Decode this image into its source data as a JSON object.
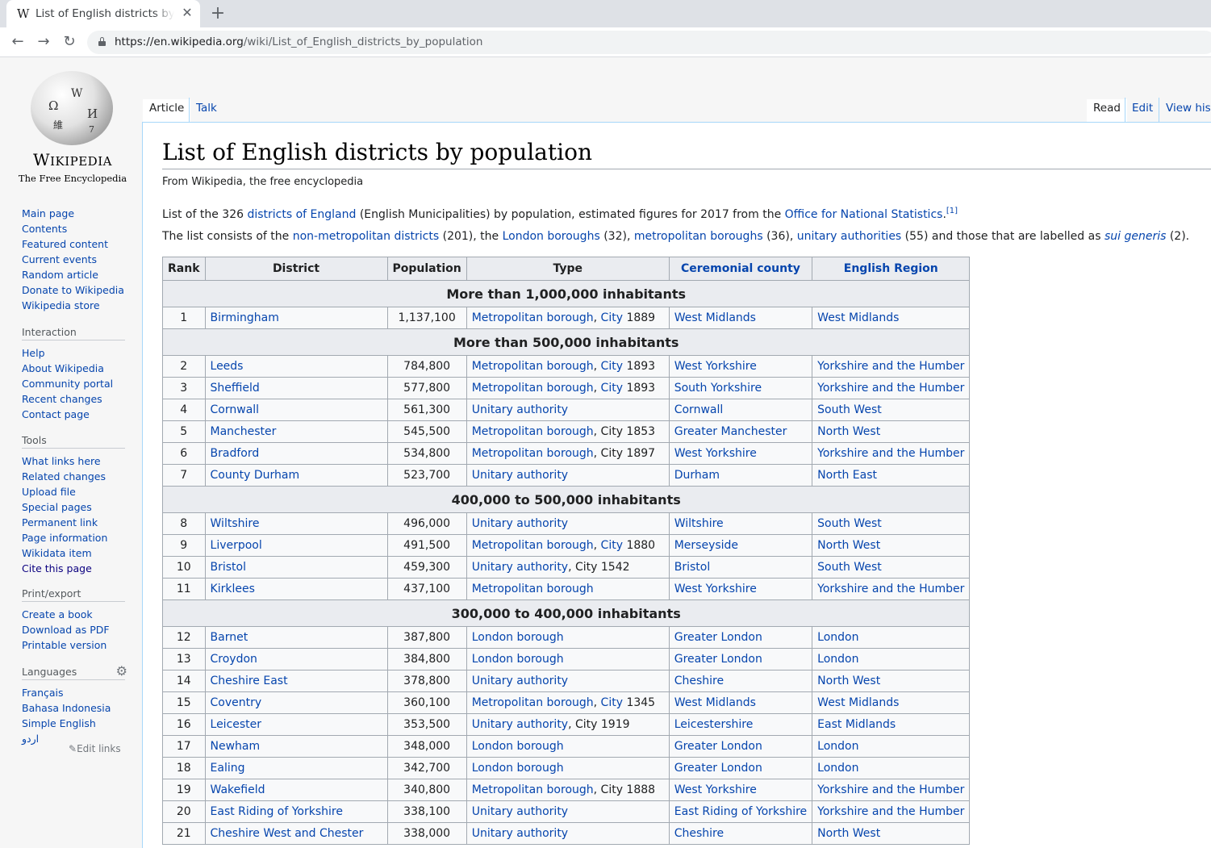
{
  "browser": {
    "tab_title": "List of English districts by population",
    "favicon": "W",
    "url_host": "https://en.wikipedia.org",
    "url_path": "/wiki/List_of_English_districts_by_population"
  },
  "logo": {
    "wordmark": "Wikipedia",
    "tagline": "The Free Encyclopedia"
  },
  "sidebar": {
    "navigation": [
      "Main page",
      "Contents",
      "Featured content",
      "Current events",
      "Random article",
      "Donate to Wikipedia",
      "Wikipedia store"
    ],
    "interaction_title": "Interaction",
    "interaction": [
      "Help",
      "About Wikipedia",
      "Community portal",
      "Recent changes",
      "Contact page"
    ],
    "tools_title": "Tools",
    "tools": [
      "What links here",
      "Related changes",
      "Upload file",
      "Special pages",
      "Permanent link",
      "Page information",
      "Wikidata item",
      "Cite this page"
    ],
    "print_title": "Print/export",
    "print": [
      "Create a book",
      "Download as PDF",
      "Printable version"
    ],
    "languages_title": "Languages",
    "languages": [
      "Français",
      "Bahasa Indonesia",
      "Simple English",
      "اردو"
    ],
    "edit_links": "Edit links"
  },
  "tabs": {
    "article": "Article",
    "talk": "Talk",
    "read": "Read",
    "edit": "Edit",
    "history": "View history"
  },
  "article": {
    "title": "List of English districts by population",
    "subtitle": "From Wikipedia, the free encyclopedia",
    "intro1": {
      "t1": "List of the 326 ",
      "l1": "districts of England",
      "t2": " (English Municipalities) by population, estimated figures for 2017 from the ",
      "l2": "Office for National Statistics",
      "t3": ".",
      "ref": "[1]"
    },
    "intro2": {
      "t1": "The list consists of the ",
      "l1": "non-metropolitan districts",
      "t2": " (201), the ",
      "l2": "London boroughs",
      "t3": " (32), ",
      "l3": "metropolitan boroughs",
      "t4": " (36), ",
      "l4": "unitary authorities",
      "t5": " (55) and those that are labelled as ",
      "l5": "sui generis",
      "t6": " (2)."
    }
  },
  "table": {
    "headers": [
      "Rank",
      "District",
      "Population",
      "Type",
      "Ceremonial county",
      "English Region"
    ],
    "rows": [
      {
        "group": "More than 1,000,000 inhabitants"
      },
      {
        "rank": "1",
        "district": "Birmingham",
        "pop": "1,137,100",
        "type": "Metropolitan borough",
        "city": "City",
        "year": "1889",
        "county": "West Midlands",
        "region": "West Midlands"
      },
      {
        "group": "More than 500,000 inhabitants"
      },
      {
        "rank": "2",
        "district": "Leeds",
        "pop": "784,800",
        "type": "Metropolitan borough",
        "city": "City",
        "year": "1893",
        "county": "West Yorkshire",
        "region": "Yorkshire and the Humber"
      },
      {
        "rank": "3",
        "district": "Sheffield",
        "pop": "577,800",
        "type": "Metropolitan borough",
        "city": "City",
        "year": "1893",
        "county": "South Yorkshire",
        "region": "Yorkshire and the Humber"
      },
      {
        "rank": "4",
        "district": "Cornwall",
        "pop": "561,300",
        "type": "Unitary authority",
        "county": "Cornwall",
        "region": "South West"
      },
      {
        "rank": "5",
        "district": "Manchester",
        "pop": "545,500",
        "type": "Metropolitan borough",
        "cityplain": "City 1853",
        "county": "Greater Manchester",
        "region": "North West"
      },
      {
        "rank": "6",
        "district": "Bradford",
        "pop": "534,800",
        "type": "Metropolitan borough",
        "cityplain": "City 1897",
        "county": "West Yorkshire",
        "region": "Yorkshire and the Humber"
      },
      {
        "rank": "7",
        "district": "County Durham",
        "pop": "523,700",
        "type": "Unitary authority",
        "county": "Durham",
        "region": "North East"
      },
      {
        "group": "400,000 to 500,000 inhabitants"
      },
      {
        "rank": "8",
        "district": "Wiltshire",
        "pop": "496,000",
        "type": "Unitary authority",
        "county": "Wiltshire",
        "region": "South West"
      },
      {
        "rank": "9",
        "district": "Liverpool",
        "pop": "491,500",
        "type": "Metropolitan borough",
        "city": "City",
        "year": "1880",
        "county": "Merseyside",
        "region": "North West"
      },
      {
        "rank": "10",
        "district": "Bristol",
        "pop": "459,300",
        "type": "Unitary authority",
        "cityplain": "City 1542",
        "county": "Bristol",
        "region": "South West"
      },
      {
        "rank": "11",
        "district": "Kirklees",
        "pop": "437,100",
        "type": "Metropolitan borough",
        "county": "West Yorkshire",
        "region": "Yorkshire and the Humber"
      },
      {
        "group": "300,000 to 400,000 inhabitants"
      },
      {
        "rank": "12",
        "district": "Barnet",
        "pop": "387,800",
        "type": "London borough",
        "county": "Greater London",
        "region": "London"
      },
      {
        "rank": "13",
        "district": "Croydon",
        "pop": "384,800",
        "type": "London borough",
        "county": "Greater London",
        "region": "London"
      },
      {
        "rank": "14",
        "district": "Cheshire East",
        "pop": "378,800",
        "type": "Unitary authority",
        "county": "Cheshire",
        "region": "North West"
      },
      {
        "rank": "15",
        "district": "Coventry",
        "pop": "360,100",
        "type": "Metropolitan borough",
        "city": "City",
        "year": "1345",
        "county": "West Midlands",
        "region": "West Midlands"
      },
      {
        "rank": "16",
        "district": "Leicester",
        "pop": "353,500",
        "type": "Unitary authority",
        "cityplain": "City 1919",
        "county": "Leicestershire",
        "region": "East Midlands"
      },
      {
        "rank": "17",
        "district": "Newham",
        "pop": "348,000",
        "type": "London borough",
        "county": "Greater London",
        "region": "London"
      },
      {
        "rank": "18",
        "district": "Ealing",
        "pop": "342,700",
        "type": "London borough",
        "county": "Greater London",
        "region": "London"
      },
      {
        "rank": "19",
        "district": "Wakefield",
        "pop": "340,800",
        "type": "Metropolitan borough",
        "cityplain": "City 1888",
        "county": "West Yorkshire",
        "region": "Yorkshire and the Humber"
      },
      {
        "rank": "20",
        "district": "East Riding of Yorkshire",
        "pop": "338,100",
        "type": "Unitary authority",
        "county": "East Riding of Yorkshire",
        "region": "Yorkshire and the Humber"
      },
      {
        "rank": "21",
        "district": "Cheshire West and Chester",
        "pop": "338,000",
        "type": "Unitary authority",
        "county": "Cheshire",
        "region": "North West"
      }
    ]
  },
  "colors": {
    "link": "#0645ad",
    "visited": "#0b0080",
    "border": "#a2a9b1",
    "header_bg": "#eaecf0"
  }
}
